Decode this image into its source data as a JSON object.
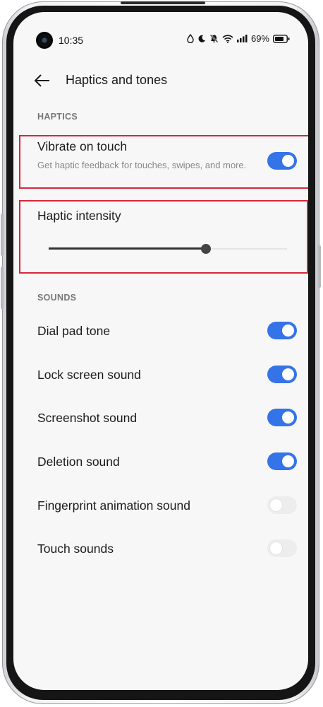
{
  "status_bar": {
    "time": "10:35",
    "battery": "69%"
  },
  "header": {
    "title": "Haptics and tones"
  },
  "sections": {
    "haptics": {
      "label": "HAPTICS"
    },
    "sounds": {
      "label": "SOUNDS"
    }
  },
  "haptics": {
    "vibrate": {
      "title": "Vibrate on touch",
      "subtitle": "Get haptic feedback for touches, swipes, and more.",
      "on": true
    },
    "intensity": {
      "title": "Haptic intensity",
      "value_fraction": 0.66
    }
  },
  "sounds": [
    {
      "title": "Dial pad tone",
      "on": true
    },
    {
      "title": "Lock screen sound",
      "on": true
    },
    {
      "title": "Screenshot sound",
      "on": true
    },
    {
      "title": "Deletion sound",
      "on": true
    },
    {
      "title": "Fingerprint animation sound",
      "on": false
    },
    {
      "title": "Touch sounds",
      "on": false
    }
  ],
  "colors": {
    "accent": "#3573e8",
    "highlight": "#d7263d"
  }
}
